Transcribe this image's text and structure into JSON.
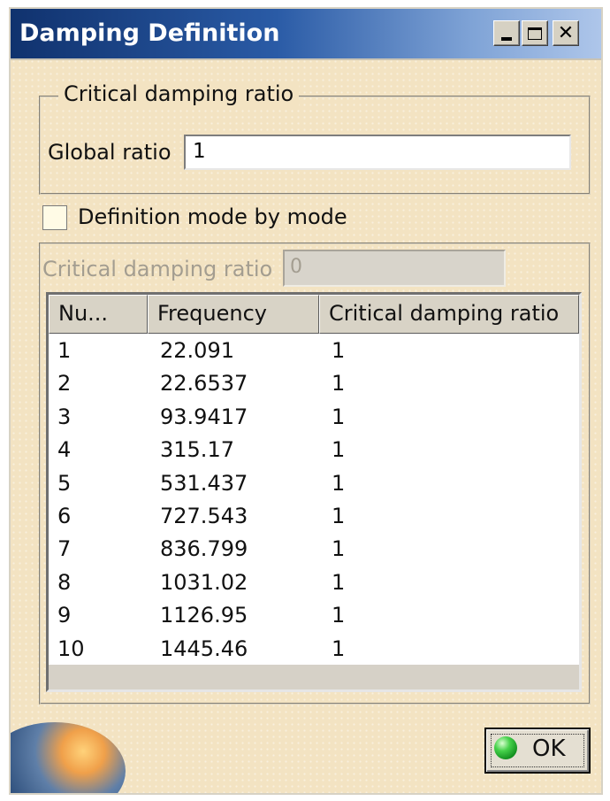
{
  "window": {
    "title": "Damping Definition"
  },
  "titlebar": {
    "minimize": "_",
    "maximize": "□",
    "close": "✕"
  },
  "critical_group": {
    "legend": "Critical damping ratio",
    "global_ratio_label": "Global ratio",
    "global_ratio_value": "1"
  },
  "mode_checkbox": {
    "label": "Definition mode by mode",
    "checked": false
  },
  "mode_panel": {
    "critical_label": "Critical damping ratio",
    "critical_value": "0",
    "table": {
      "columns": [
        "Nu...",
        "Frequency",
        "Critical damping ratio"
      ],
      "rows": [
        [
          "1",
          "22.091",
          "1"
        ],
        [
          "2",
          "22.6537",
          "1"
        ],
        [
          "3",
          "93.9417",
          "1"
        ],
        [
          "4",
          "315.17",
          "1"
        ],
        [
          "5",
          "531.437",
          "1"
        ],
        [
          "6",
          "727.543",
          "1"
        ],
        [
          "7",
          "836.799",
          "1"
        ],
        [
          "8",
          "1031.02",
          "1"
        ],
        [
          "9",
          "1126.95",
          "1"
        ],
        [
          "10",
          "1445.46",
          "1"
        ]
      ]
    }
  },
  "footer": {
    "ok_label": "OK",
    "logo_icon": "catia-logo-icon",
    "ok_icon": "green-ball-icon"
  }
}
